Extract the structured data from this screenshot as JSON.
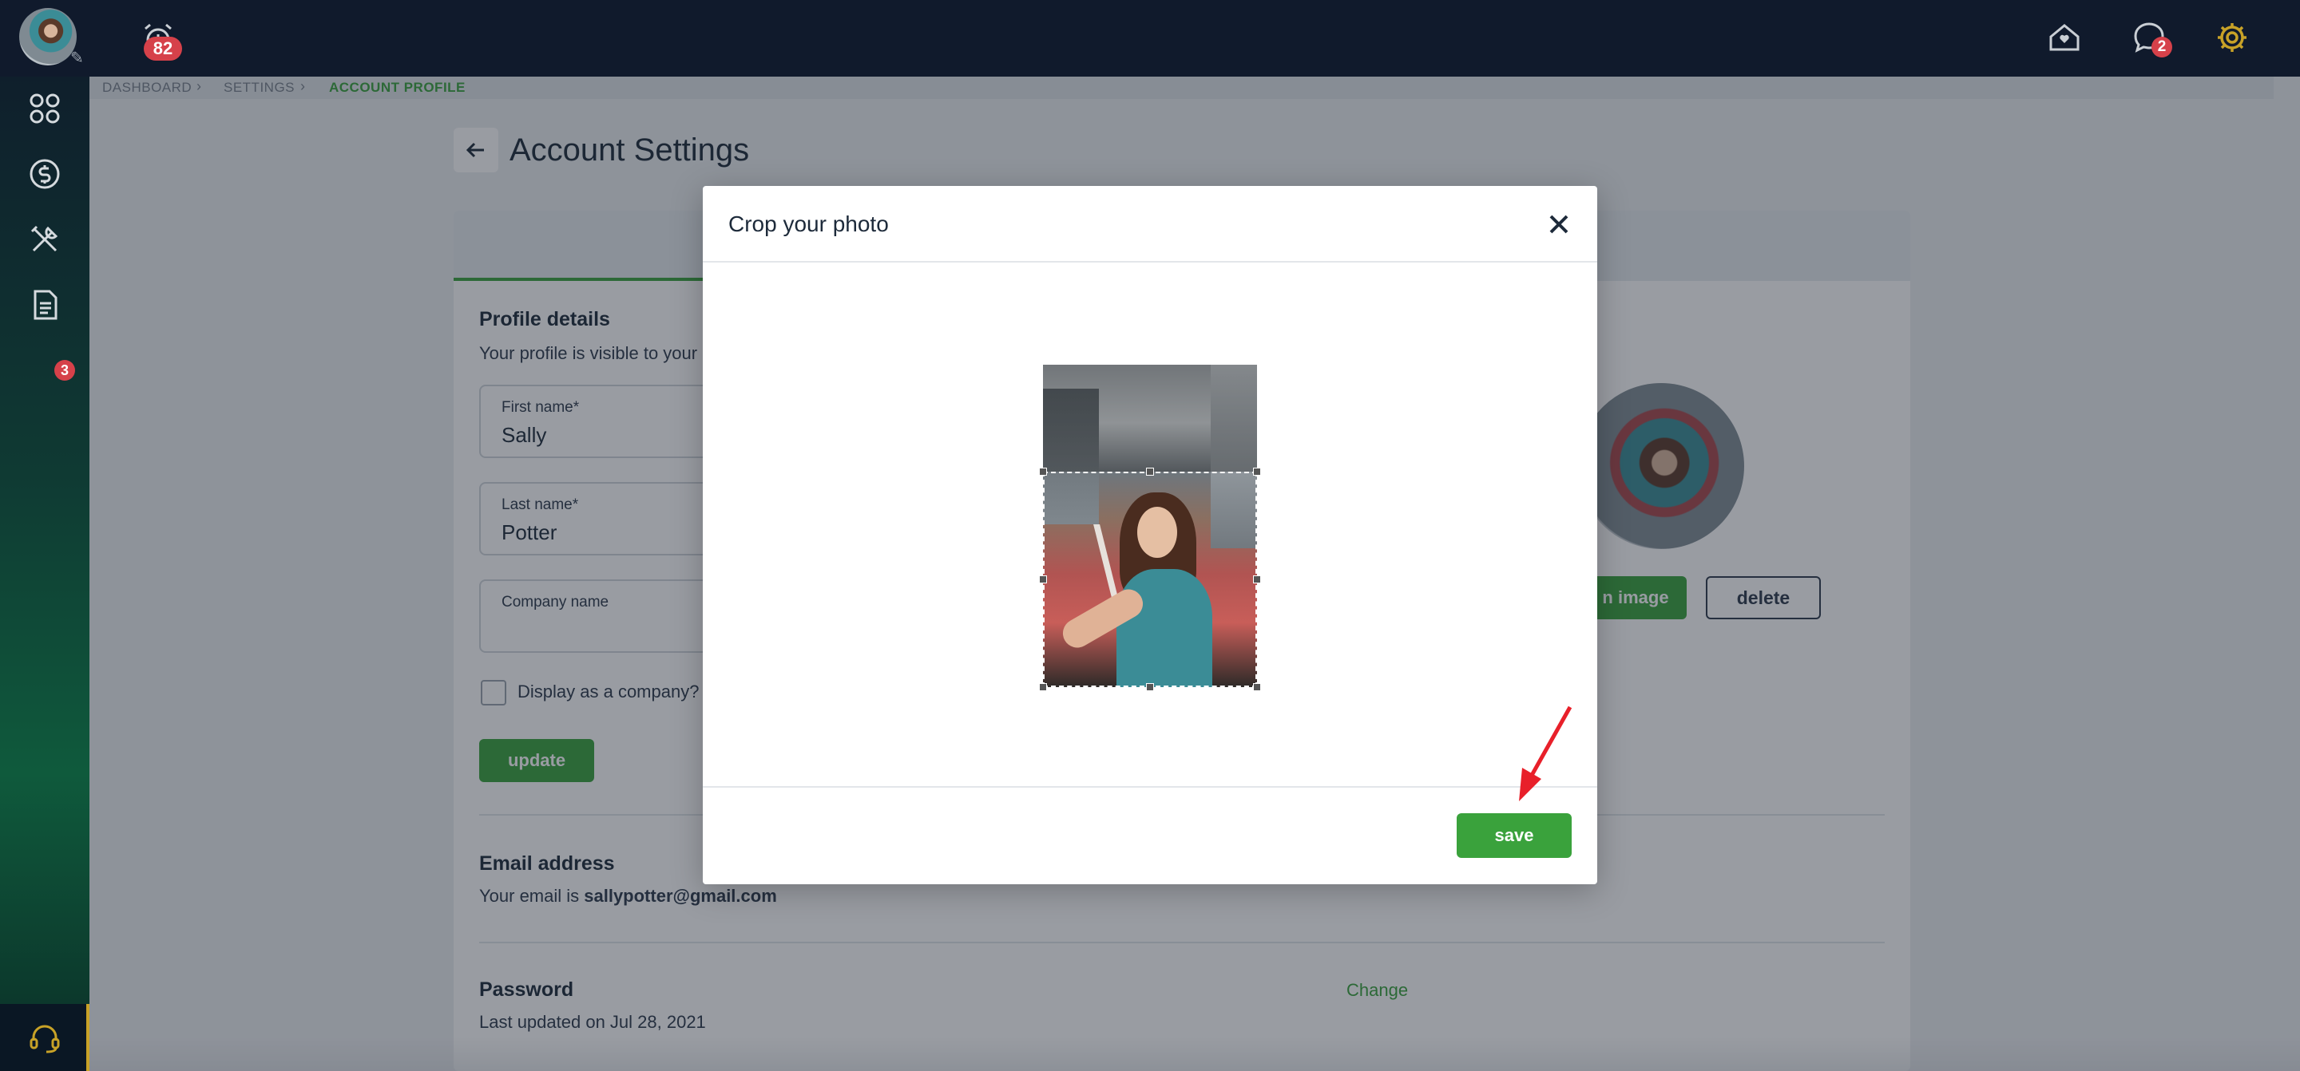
{
  "topbar": {
    "alarm_badge": "82",
    "chat_badge": "2"
  },
  "sidebar": {
    "documents_badge": "3",
    "icons": [
      "apps-grid-icon",
      "dollar-circle-icon",
      "tools-icon",
      "document-icon",
      "headset-icon"
    ]
  },
  "breadcrumb": {
    "items": [
      "DASHBOARD",
      "SETTINGS",
      "ACCOUNT PROFILE"
    ]
  },
  "page": {
    "title": "Account Settings"
  },
  "profile": {
    "section_title": "Profile details",
    "section_sub": "Your profile is visible to your",
    "first_name_label": "First name*",
    "first_name_value": "Sally",
    "last_name_label": "Last name*",
    "last_name_value": "Potter",
    "company_label": "Company name",
    "company_value": "",
    "display_company_label": "Display as a company?",
    "update_label": "update",
    "upload_label": "n image",
    "delete_label": "delete"
  },
  "email": {
    "section_title": "Email address",
    "prefix": "Your email is ",
    "address": "sallypotter@gmail.com"
  },
  "password": {
    "section_title": "Password",
    "updated": "Last updated on Jul 28, 2021",
    "change_label": "Change"
  },
  "modal": {
    "title": "Crop your photo",
    "save_label": "save"
  },
  "colors": {
    "accent_green": "#3aa23c",
    "topbar": "#101a2c",
    "badge_red": "#d6414a",
    "gear_gold": "#c8a227",
    "annotation_red": "#e8202a"
  }
}
